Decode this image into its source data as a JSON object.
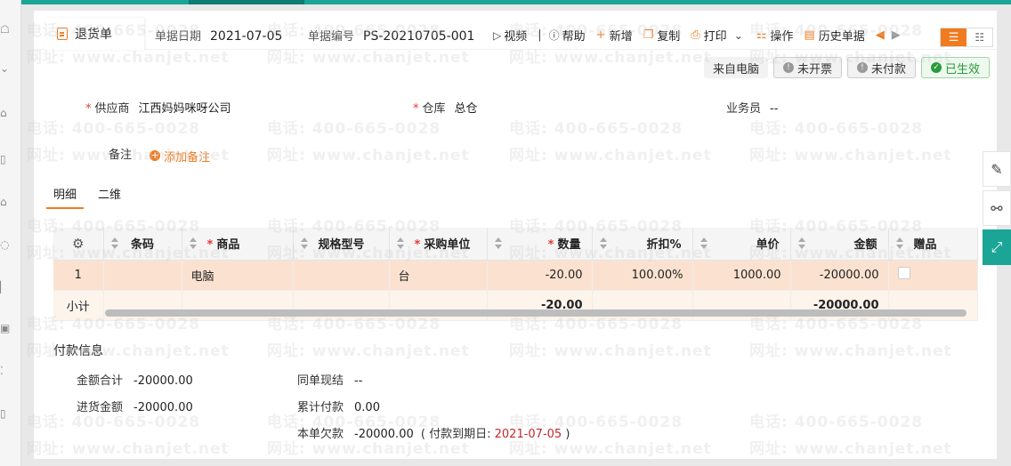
{
  "document": {
    "title": "退货单",
    "date_label": "单据日期",
    "date_value": "2021-07-05",
    "number_label": "单据编号",
    "number_value": "PS-20210705-001"
  },
  "toolbar": {
    "video": "视频",
    "separator": "|",
    "help": "帮助",
    "add": "新增",
    "copy": "复制",
    "print": "打印",
    "operate": "操作",
    "history": "历史单据"
  },
  "status": {
    "source": "来自电脑",
    "invoice": "未开票",
    "payment": "未付款",
    "effective": "已生效"
  },
  "form": {
    "supplier_label": "供应商",
    "supplier_value": "江西妈妈咪呀公司",
    "warehouse_label": "仓库",
    "warehouse_value": "总仓",
    "salesman_label": "业务员",
    "salesman_value": "--",
    "remark_label": "备注",
    "add_remark": "添加备注"
  },
  "tabs": [
    "明细",
    "二维"
  ],
  "table": {
    "columns": [
      "条码",
      "商品",
      "规格型号",
      "采购单位",
      "数量",
      "折扣%",
      "单价",
      "金额",
      "赠品"
    ],
    "rows": [
      {
        "index": "1",
        "barcode": "",
        "product": "电脑",
        "spec": "",
        "unit": "台",
        "qty": "-20.00",
        "discount": "100.00%",
        "price": "1000.00",
        "amount": "-20000.00"
      }
    ],
    "subtotal": {
      "label": "小计",
      "qty": "-20.00",
      "amount": "-20000.00"
    }
  },
  "payment": {
    "section_title": "付款信息",
    "total_label": "金额合计",
    "total_value": "-20000.00",
    "purchase_label": "进货金额",
    "purchase_value": "-20000.00",
    "cash_label": "同单现结",
    "cash_value": "--",
    "accum_label": "累计付款",
    "accum_value": "0.00",
    "owed_label": "本单欠款",
    "owed_value": "-20000.00",
    "due_prefix": "( 付款到期日:",
    "due_value": "2021-07-05",
    "due_suffix": ")"
  },
  "watermark": {
    "phone": "电话: 400-665-0028",
    "site": "网址: www.chanjet.net"
  },
  "colors": {
    "accent": "#f07a1e",
    "teal": "#1aa597",
    "green": "#2a9a3d",
    "red": "#c62828"
  }
}
